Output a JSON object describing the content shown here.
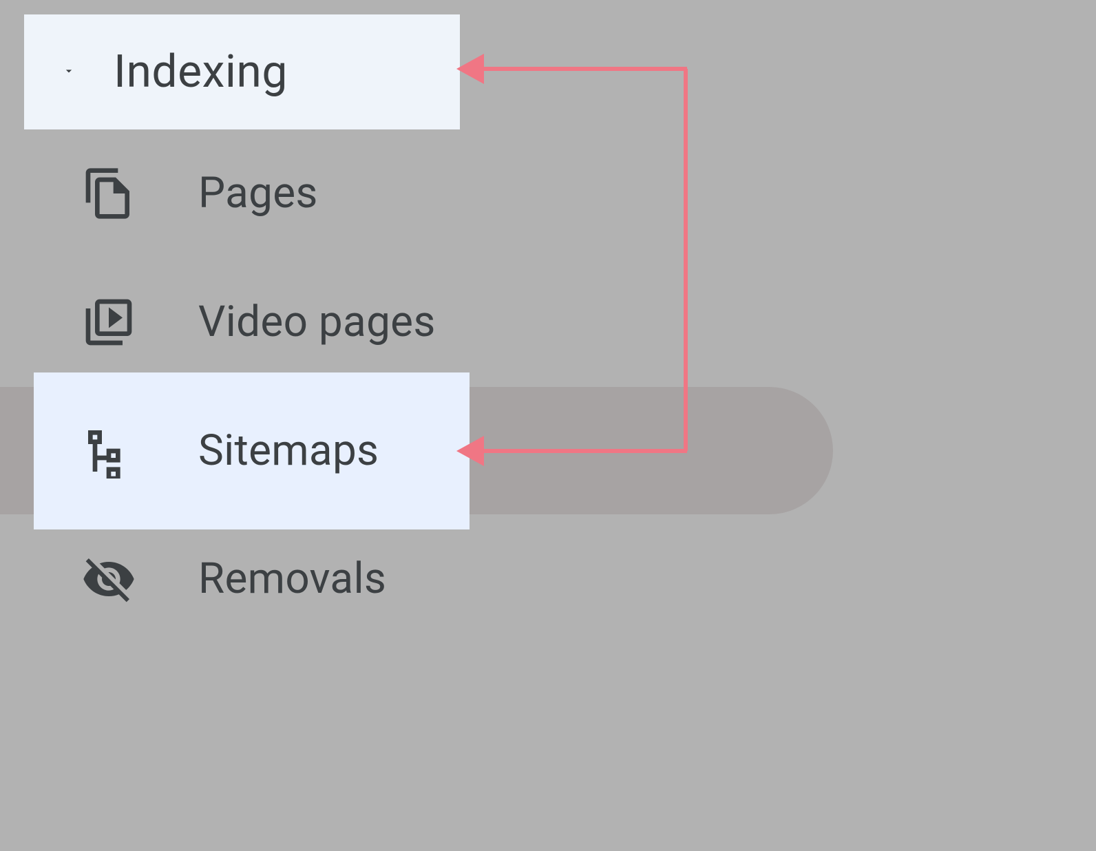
{
  "sidebar": {
    "section": {
      "title": "Indexing"
    },
    "items": [
      {
        "label": "Pages",
        "icon": "pages-icon"
      },
      {
        "label": "Video pages",
        "icon": "video-icon"
      },
      {
        "label": "Sitemaps",
        "icon": "sitemaps-icon"
      },
      {
        "label": "Removals",
        "icon": "removals-icon"
      }
    ]
  },
  "annotation": {
    "arrow_color": "#f07684"
  }
}
